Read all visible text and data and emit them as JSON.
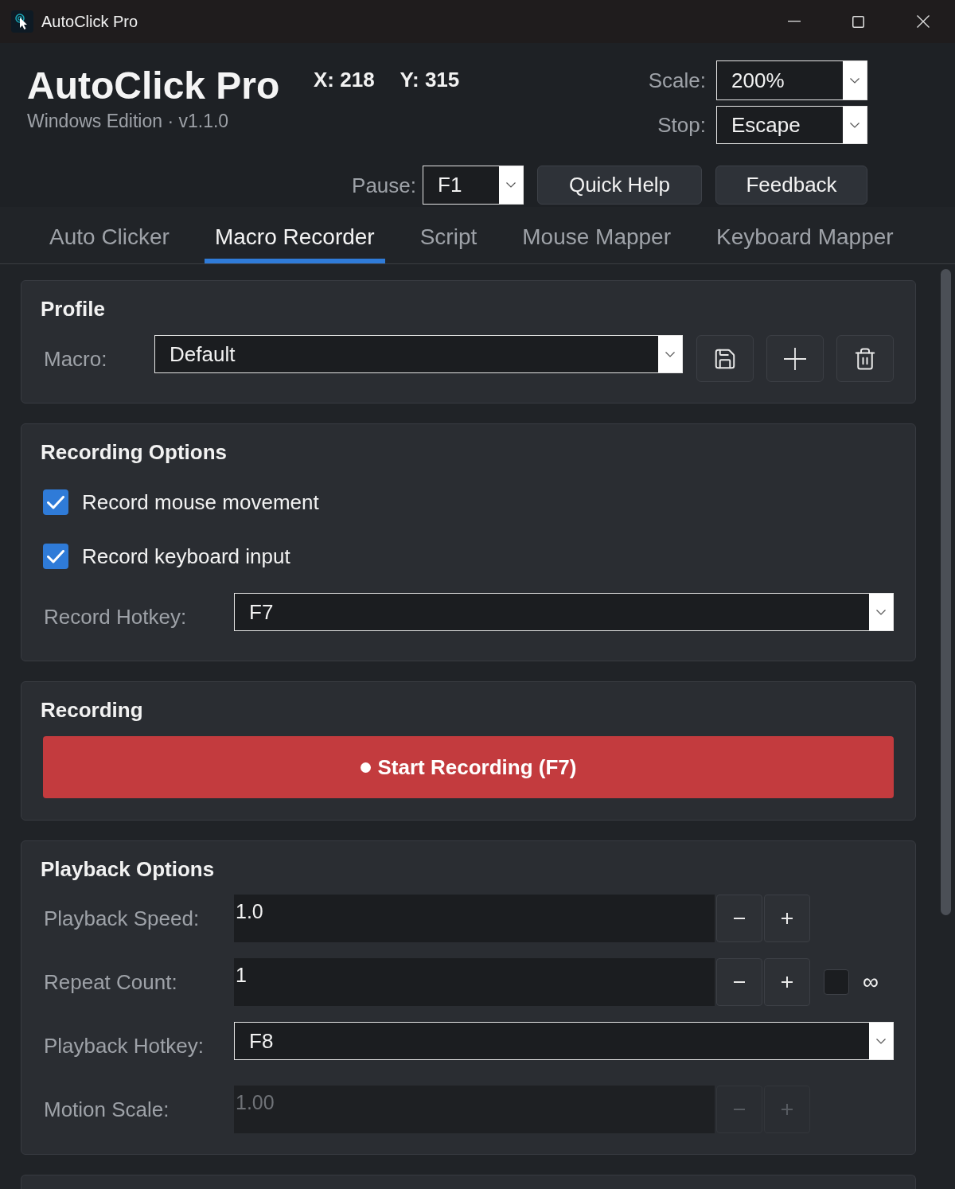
{
  "window": {
    "title": "AutoClick Pro"
  },
  "header": {
    "title": "AutoClick Pro",
    "subtitle": "Windows Edition · v1.1.0",
    "cursor_x": "X: 218",
    "cursor_y": "Y: 315"
  },
  "hotkey_settings": [
    {
      "label": "Scale:",
      "value": "200%"
    },
    {
      "label": "Stop:",
      "value": "Escape"
    }
  ],
  "pause": {
    "label": "Pause:",
    "value": "F1"
  },
  "header_buttons": [
    {
      "label": "Quick Help"
    },
    {
      "label": "Feedback"
    }
  ],
  "tabs": [
    {
      "label": "Auto Clicker",
      "selected": false
    },
    {
      "label": "Macro Recorder",
      "selected": true
    },
    {
      "label": "Script",
      "selected": false
    },
    {
      "label": "Mouse Mapper",
      "selected": false
    },
    {
      "label": "Keyboard Mapper",
      "selected": false
    }
  ],
  "profile": {
    "title": "Profile",
    "label": "Macro:",
    "value": "Default"
  },
  "recording_options": {
    "title": "Recording Options",
    "checkboxes": [
      {
        "label": "Record mouse movement",
        "checked": true
      },
      {
        "label": "Record keyboard input",
        "checked": true
      }
    ],
    "hotkey": {
      "label": "Record Hotkey:",
      "value": "F7"
    }
  },
  "recording": {
    "title": "Recording",
    "button": "Start Recording (F7)"
  },
  "playback_options": {
    "title": "Playback Options",
    "rows": [
      {
        "kind": "spinner",
        "label": "Playback Speed:",
        "value": "1.0",
        "disabled": false
      },
      {
        "kind": "spinner",
        "label": "Repeat Count:",
        "value": "1",
        "disabled": false,
        "infinite": {
          "label": "∞",
          "checked": false
        }
      },
      {
        "kind": "dropdown",
        "label": "Playback Hotkey:",
        "value": "F8"
      },
      {
        "kind": "spinner",
        "label": "Motion Scale:",
        "value": "1.00",
        "disabled": true
      }
    ]
  }
}
